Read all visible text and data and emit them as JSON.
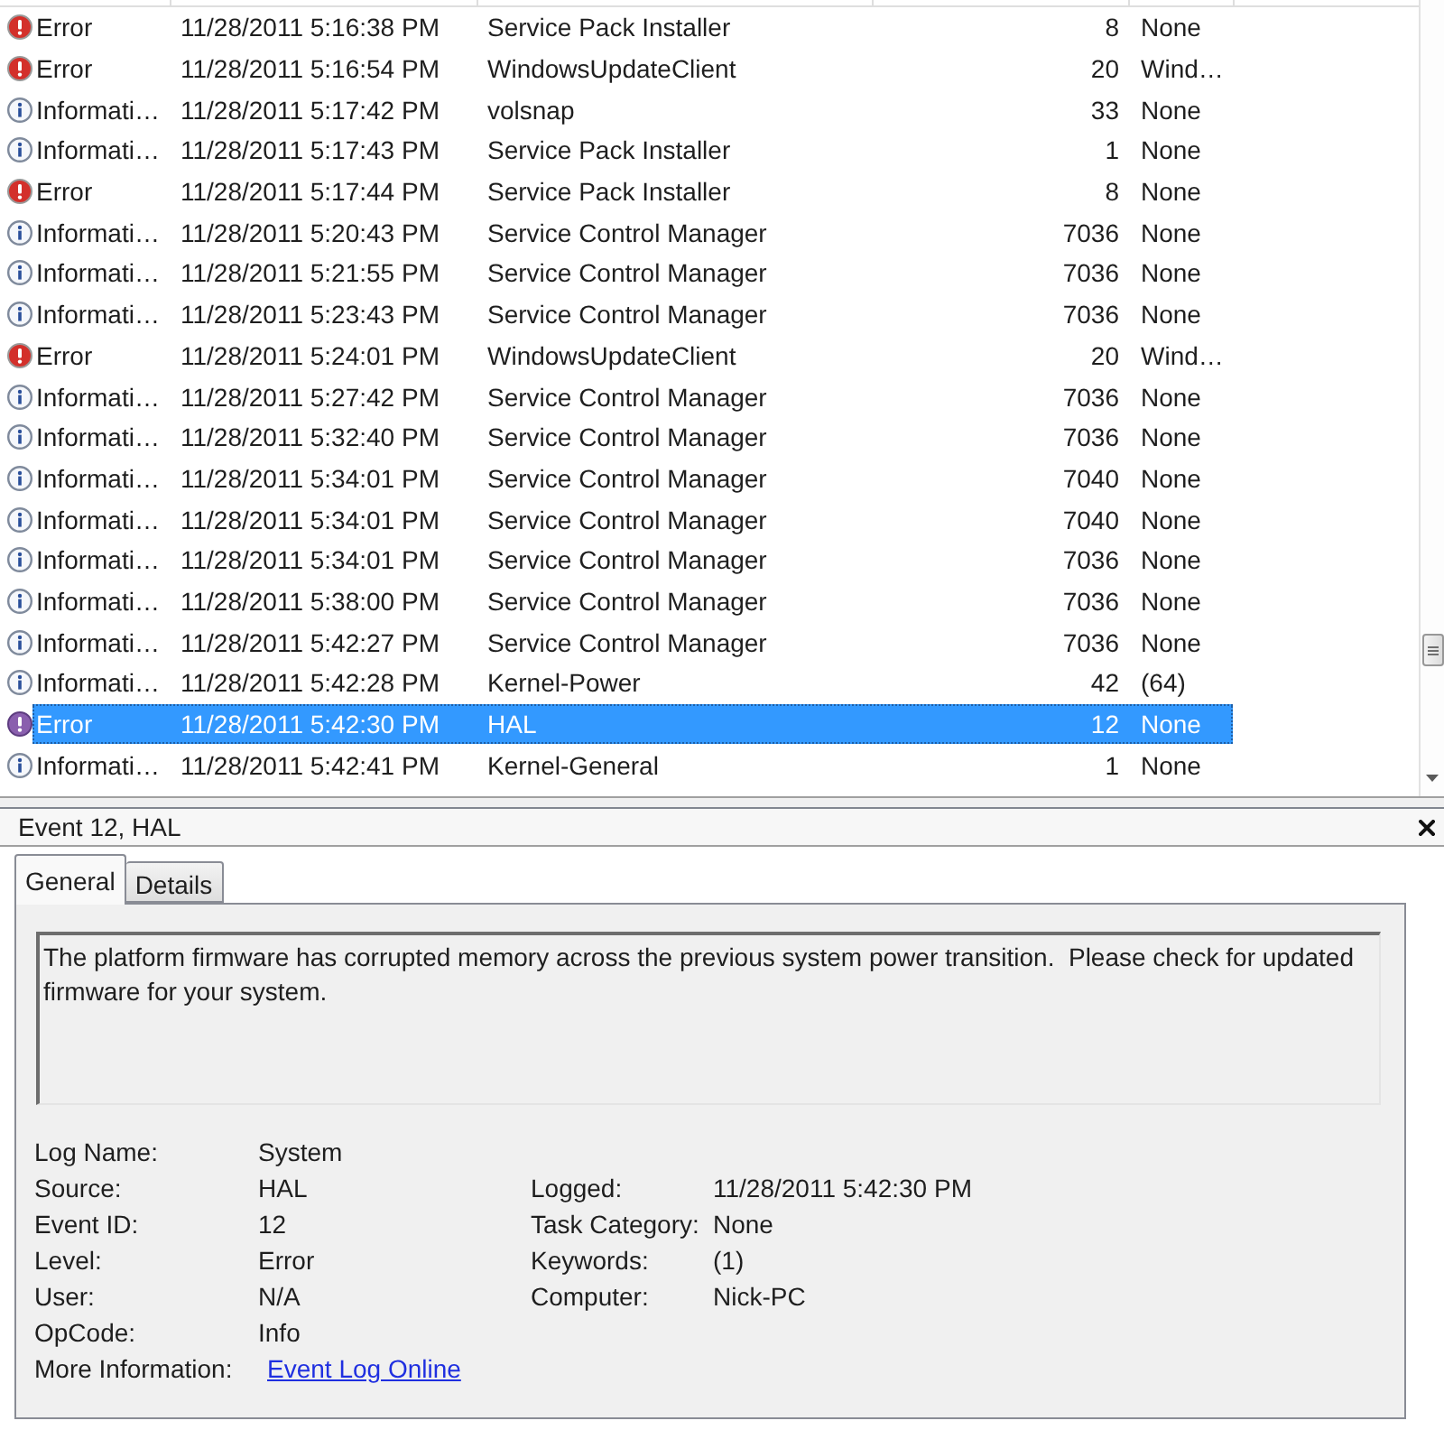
{
  "event_list": {
    "rows": [
      {
        "kind": "error",
        "level_name": "Error",
        "date_time": "11/28/2011 5:16:38 PM",
        "source": "Service Pack Installer",
        "event_id": "8",
        "task_category": "None",
        "selected": false
      },
      {
        "kind": "error",
        "level_name": "Error",
        "date_time": "11/28/2011 5:16:54 PM",
        "source": "WindowsUpdateClient",
        "event_id": "20",
        "task_category": "Wind…",
        "selected": false
      },
      {
        "kind": "information",
        "level_name": "Informati…",
        "date_time": "11/28/2011 5:17:42 PM",
        "source": "volsnap",
        "event_id": "33",
        "task_category": "None",
        "selected": false
      },
      {
        "kind": "information",
        "level_name": "Informati…",
        "date_time": "11/28/2011 5:17:43 PM",
        "source": "Service Pack Installer",
        "event_id": "1",
        "task_category": "None",
        "selected": false
      },
      {
        "kind": "error",
        "level_name": "Error",
        "date_time": "11/28/2011 5:17:44 PM",
        "source": "Service Pack Installer",
        "event_id": "8",
        "task_category": "None",
        "selected": false
      },
      {
        "kind": "information",
        "level_name": "Informati…",
        "date_time": "11/28/2011 5:20:43 PM",
        "source": "Service Control Manager",
        "event_id": "7036",
        "task_category": "None",
        "selected": false
      },
      {
        "kind": "information",
        "level_name": "Informati…",
        "date_time": "11/28/2011 5:21:55 PM",
        "source": "Service Control Manager",
        "event_id": "7036",
        "task_category": "None",
        "selected": false
      },
      {
        "kind": "information",
        "level_name": "Informati…",
        "date_time": "11/28/2011 5:23:43 PM",
        "source": "Service Control Manager",
        "event_id": "7036",
        "task_category": "None",
        "selected": false
      },
      {
        "kind": "error",
        "level_name": "Error",
        "date_time": "11/28/2011 5:24:01 PM",
        "source": "WindowsUpdateClient",
        "event_id": "20",
        "task_category": "Wind…",
        "selected": false
      },
      {
        "kind": "information",
        "level_name": "Informati…",
        "date_time": "11/28/2011 5:27:42 PM",
        "source": "Service Control Manager",
        "event_id": "7036",
        "task_category": "None",
        "selected": false
      },
      {
        "kind": "information",
        "level_name": "Informati…",
        "date_time": "11/28/2011 5:32:40 PM",
        "source": "Service Control Manager",
        "event_id": "7036",
        "task_category": "None",
        "selected": false
      },
      {
        "kind": "information",
        "level_name": "Informati…",
        "date_time": "11/28/2011 5:34:01 PM",
        "source": "Service Control Manager",
        "event_id": "7040",
        "task_category": "None",
        "selected": false
      },
      {
        "kind": "information",
        "level_name": "Informati…",
        "date_time": "11/28/2011 5:34:01 PM",
        "source": "Service Control Manager",
        "event_id": "7040",
        "task_category": "None",
        "selected": false
      },
      {
        "kind": "information",
        "level_name": "Informati…",
        "date_time": "11/28/2011 5:34:01 PM",
        "source": "Service Control Manager",
        "event_id": "7036",
        "task_category": "None",
        "selected": false
      },
      {
        "kind": "information",
        "level_name": "Informati…",
        "date_time": "11/28/2011 5:38:00 PM",
        "source": "Service Control Manager",
        "event_id": "7036",
        "task_category": "None",
        "selected": false
      },
      {
        "kind": "information",
        "level_name": "Informati…",
        "date_time": "11/28/2011 5:42:27 PM",
        "source": "Service Control Manager",
        "event_id": "7036",
        "task_category": "None",
        "selected": false
      },
      {
        "kind": "information",
        "level_name": "Informati…",
        "date_time": "11/28/2011 5:42:28 PM",
        "source": "Kernel-Power",
        "event_id": "42",
        "task_category": "(64)",
        "selected": false
      },
      {
        "kind": "error",
        "level_name": "Error",
        "date_time": "11/28/2011 5:42:30 PM",
        "source": "HAL",
        "event_id": "12",
        "task_category": "None",
        "selected": true
      },
      {
        "kind": "information",
        "level_name": "Informati…",
        "date_time": "11/28/2011 5:42:41 PM",
        "source": "Kernel-General",
        "event_id": "1",
        "task_category": "None",
        "selected": false
      }
    ]
  },
  "event_pane": {
    "title": "Event 12, HAL",
    "tabs": [
      {
        "label": "General",
        "selected": true
      },
      {
        "label": "Details",
        "selected": false
      }
    ],
    "description": "The platform firmware has corrupted memory across the previous system power transition.  Please check for updated firmware for your system.",
    "details": {
      "rows": [
        [
          {
            "label": "Log Name:",
            "value": "System"
          }
        ],
        [
          {
            "label": "Source:",
            "value": "HAL"
          },
          {
            "label": "Logged:",
            "value": "11/28/2011 5:42:30 PM"
          }
        ],
        [
          {
            "label": "Event ID:",
            "value": "12"
          },
          {
            "label": "Task Category:",
            "value": "None"
          }
        ],
        [
          {
            "label": "Level:",
            "value": "Error"
          },
          {
            "label": "Keywords:",
            "value": "(1)"
          }
        ],
        [
          {
            "label": "User:",
            "value": "N/A"
          },
          {
            "label": "Computer:",
            "value": "Nick-PC"
          }
        ],
        [
          {
            "label": "OpCode:",
            "value": "Info"
          }
        ]
      ],
      "more_information": {
        "label": "More Information:",
        "link": "Event Log Online"
      }
    }
  }
}
